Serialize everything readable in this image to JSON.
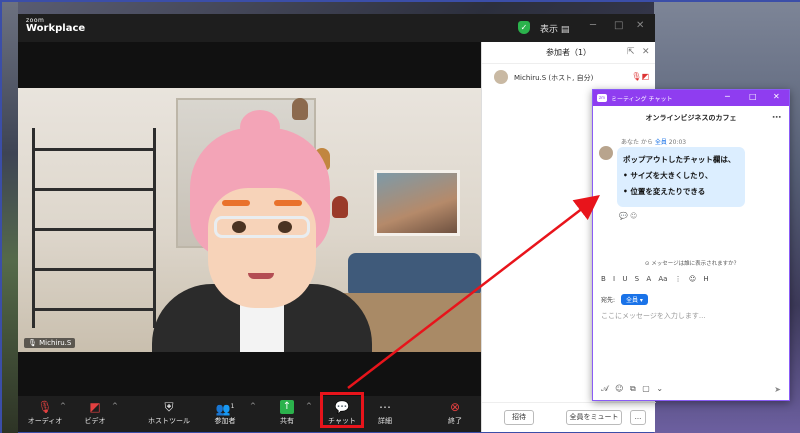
{
  "brand": {
    "small": "zoom",
    "big": "Workplace"
  },
  "titlebar": {
    "view_label": "表示"
  },
  "video": {
    "participant_name": "Michiru.S"
  },
  "toolbar": {
    "audio": "オーディオ",
    "video": "ビデオ",
    "host_tools": "ホストツール",
    "participants": "参加者",
    "participants_count": "1",
    "share": "共有",
    "chat": "チャット",
    "more": "詳細",
    "end": "終了"
  },
  "participants_panel": {
    "title": "参加者（1）",
    "rows": [
      {
        "name": "Michiru.S (ホスト, 自分)"
      }
    ],
    "invite": "招待",
    "mute_all": "全員をミュート",
    "more": "..."
  },
  "chat_window": {
    "window_title": "ミーティング チャット",
    "meeting_name": "オンラインビジネスのカフェ",
    "meta_from": "あなた から",
    "meta_to": "全員",
    "meta_time": "20:03",
    "message_lines": [
      "ポップアウトしたチャット欄は、",
      "• サイズを大きくしたり、",
      "• 位置を変えたりできる"
    ],
    "visibility_notice": "メッセージは誰に表示されますか？",
    "format_bar": "B I U S A Aa ⋮ ☺ H",
    "to_label": "宛先:",
    "to_value": "全員",
    "placeholder": "ここにメッセージを入力します..."
  },
  "colors": {
    "highlight": "#e8141b",
    "chat_bar": "#8f3df0",
    "accent": "#1a73e8"
  }
}
